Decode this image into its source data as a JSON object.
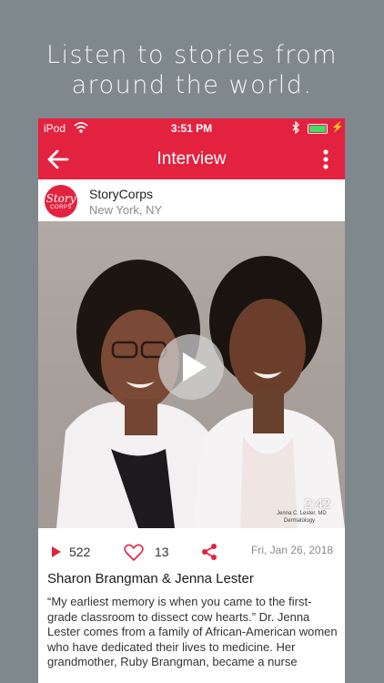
{
  "tagline": {
    "line1": "Listen to stories from",
    "line2": "around the world."
  },
  "status_bar": {
    "carrier": "iPod",
    "time": "3:51 PM"
  },
  "nav": {
    "title": "Interview"
  },
  "organization": {
    "logo_line1": "Story",
    "logo_line2": "CORPS",
    "name": "StoryCorps",
    "location": "New York, NY"
  },
  "media": {
    "duration": "2:42"
  },
  "stats": {
    "plays": "522",
    "likes": "13",
    "date": "Fri, Jan 26, 2018"
  },
  "story": {
    "title": "Sharon Brangman & Jenna Lester",
    "description": "“My earliest memory is when you came to the first-grade classroom to dissect cow hearts.” Dr. Jenna Lester comes from a family of African-American women who have dedicated their lives to medicine. Her grandmother, Ruby Brangman, became a nurse"
  },
  "colors": {
    "brand_red": "#e3223f",
    "page_background": "#7f888d",
    "battery_green": "#4cd964"
  },
  "icons": [
    "back-arrow-icon",
    "more-vertical-icon",
    "wifi-icon",
    "bluetooth-icon",
    "battery-icon",
    "play-icon",
    "heart-icon",
    "share-icon"
  ]
}
